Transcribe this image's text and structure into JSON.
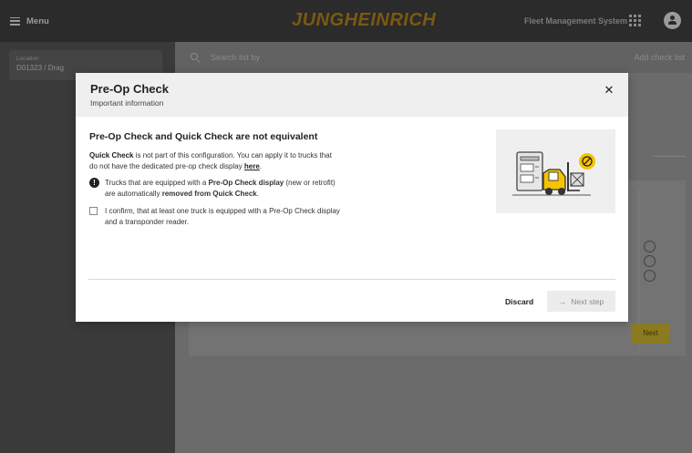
{
  "topbar": {
    "menu_label": "Menu",
    "brand": "JUNGHEINRICH",
    "app_name": "Fleet Management System",
    "brand_color": "#c9a227"
  },
  "sidebar": {
    "location_label": "Location",
    "location_value": "D01323 / Drag"
  },
  "main": {
    "search_placeholder": "Search list by",
    "add_checklist_label": "Add check list",
    "next_label": "Next"
  },
  "modal": {
    "title": "Pre-Op Check",
    "subtitle": "Important information",
    "close_icon": "close-icon",
    "section_title": "Pre-Op Check and Quick Check are not equivalent",
    "para": {
      "bold_prefix": "Quick Check",
      "text": " is not part of this configuration. You can apply it to trucks that do not have the dedicated pre-op check display ",
      "link": "here",
      "suffix": "."
    },
    "info": {
      "icon": "exclamation-icon",
      "part1": "Trucks that are equipped with a ",
      "bold1": "Pre-Op Check display",
      "part2": " (new or retrofit) are automatically ",
      "bold2": "removed from Quick Check",
      "part3": "."
    },
    "confirm_text": "I confirm, that at least one truck is equipped with a Pre-Op Check display and a transponder reader.",
    "confirm_checked": false,
    "discard_label": "Discard",
    "next_step_label": "Next step",
    "next_step_icon": "arrow-right-icon",
    "accent_color": "#f5c400"
  }
}
